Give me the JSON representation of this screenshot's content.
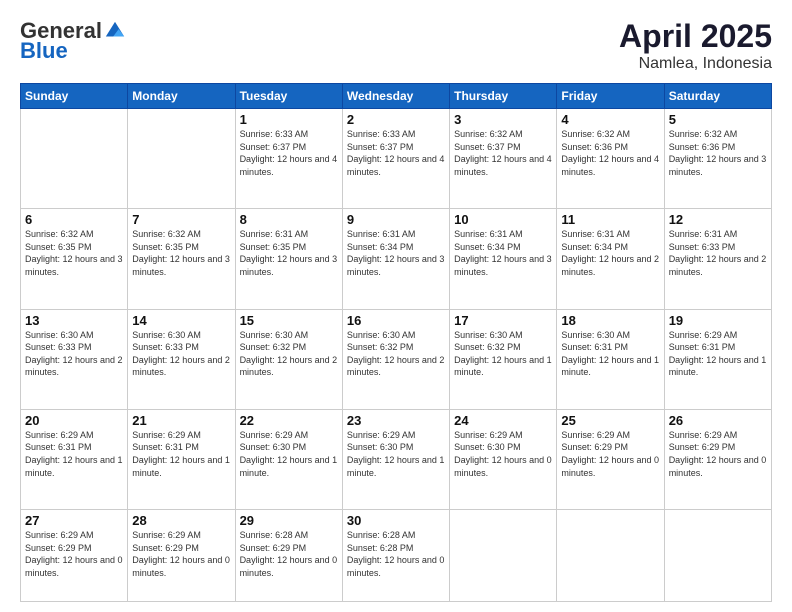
{
  "logo": {
    "general": "General",
    "blue": "Blue"
  },
  "header": {
    "month": "April 2025",
    "location": "Namlea, Indonesia"
  },
  "days_of_week": [
    "Sunday",
    "Monday",
    "Tuesday",
    "Wednesday",
    "Thursday",
    "Friday",
    "Saturday"
  ],
  "weeks": [
    [
      {
        "day": "",
        "info": ""
      },
      {
        "day": "",
        "info": ""
      },
      {
        "day": "1",
        "info": "Sunrise: 6:33 AM\nSunset: 6:37 PM\nDaylight: 12 hours and 4 minutes."
      },
      {
        "day": "2",
        "info": "Sunrise: 6:33 AM\nSunset: 6:37 PM\nDaylight: 12 hours and 4 minutes."
      },
      {
        "day": "3",
        "info": "Sunrise: 6:32 AM\nSunset: 6:37 PM\nDaylight: 12 hours and 4 minutes."
      },
      {
        "day": "4",
        "info": "Sunrise: 6:32 AM\nSunset: 6:36 PM\nDaylight: 12 hours and 4 minutes."
      },
      {
        "day": "5",
        "info": "Sunrise: 6:32 AM\nSunset: 6:36 PM\nDaylight: 12 hours and 3 minutes."
      }
    ],
    [
      {
        "day": "6",
        "info": "Sunrise: 6:32 AM\nSunset: 6:35 PM\nDaylight: 12 hours and 3 minutes."
      },
      {
        "day": "7",
        "info": "Sunrise: 6:32 AM\nSunset: 6:35 PM\nDaylight: 12 hours and 3 minutes."
      },
      {
        "day": "8",
        "info": "Sunrise: 6:31 AM\nSunset: 6:35 PM\nDaylight: 12 hours and 3 minutes."
      },
      {
        "day": "9",
        "info": "Sunrise: 6:31 AM\nSunset: 6:34 PM\nDaylight: 12 hours and 3 minutes."
      },
      {
        "day": "10",
        "info": "Sunrise: 6:31 AM\nSunset: 6:34 PM\nDaylight: 12 hours and 3 minutes."
      },
      {
        "day": "11",
        "info": "Sunrise: 6:31 AM\nSunset: 6:34 PM\nDaylight: 12 hours and 2 minutes."
      },
      {
        "day": "12",
        "info": "Sunrise: 6:31 AM\nSunset: 6:33 PM\nDaylight: 12 hours and 2 minutes."
      }
    ],
    [
      {
        "day": "13",
        "info": "Sunrise: 6:30 AM\nSunset: 6:33 PM\nDaylight: 12 hours and 2 minutes."
      },
      {
        "day": "14",
        "info": "Sunrise: 6:30 AM\nSunset: 6:33 PM\nDaylight: 12 hours and 2 minutes."
      },
      {
        "day": "15",
        "info": "Sunrise: 6:30 AM\nSunset: 6:32 PM\nDaylight: 12 hours and 2 minutes."
      },
      {
        "day": "16",
        "info": "Sunrise: 6:30 AM\nSunset: 6:32 PM\nDaylight: 12 hours and 2 minutes."
      },
      {
        "day": "17",
        "info": "Sunrise: 6:30 AM\nSunset: 6:32 PM\nDaylight: 12 hours and 1 minute."
      },
      {
        "day": "18",
        "info": "Sunrise: 6:30 AM\nSunset: 6:31 PM\nDaylight: 12 hours and 1 minute."
      },
      {
        "day": "19",
        "info": "Sunrise: 6:29 AM\nSunset: 6:31 PM\nDaylight: 12 hours and 1 minute."
      }
    ],
    [
      {
        "day": "20",
        "info": "Sunrise: 6:29 AM\nSunset: 6:31 PM\nDaylight: 12 hours and 1 minute."
      },
      {
        "day": "21",
        "info": "Sunrise: 6:29 AM\nSunset: 6:31 PM\nDaylight: 12 hours and 1 minute."
      },
      {
        "day": "22",
        "info": "Sunrise: 6:29 AM\nSunset: 6:30 PM\nDaylight: 12 hours and 1 minute."
      },
      {
        "day": "23",
        "info": "Sunrise: 6:29 AM\nSunset: 6:30 PM\nDaylight: 12 hours and 1 minute."
      },
      {
        "day": "24",
        "info": "Sunrise: 6:29 AM\nSunset: 6:30 PM\nDaylight: 12 hours and 0 minutes."
      },
      {
        "day": "25",
        "info": "Sunrise: 6:29 AM\nSunset: 6:29 PM\nDaylight: 12 hours and 0 minutes."
      },
      {
        "day": "26",
        "info": "Sunrise: 6:29 AM\nSunset: 6:29 PM\nDaylight: 12 hours and 0 minutes."
      }
    ],
    [
      {
        "day": "27",
        "info": "Sunrise: 6:29 AM\nSunset: 6:29 PM\nDaylight: 12 hours and 0 minutes."
      },
      {
        "day": "28",
        "info": "Sunrise: 6:29 AM\nSunset: 6:29 PM\nDaylight: 12 hours and 0 minutes."
      },
      {
        "day": "29",
        "info": "Sunrise: 6:28 AM\nSunset: 6:29 PM\nDaylight: 12 hours and 0 minutes."
      },
      {
        "day": "30",
        "info": "Sunrise: 6:28 AM\nSunset: 6:28 PM\nDaylight: 12 hours and 0 minutes."
      },
      {
        "day": "",
        "info": ""
      },
      {
        "day": "",
        "info": ""
      },
      {
        "day": "",
        "info": ""
      }
    ]
  ]
}
